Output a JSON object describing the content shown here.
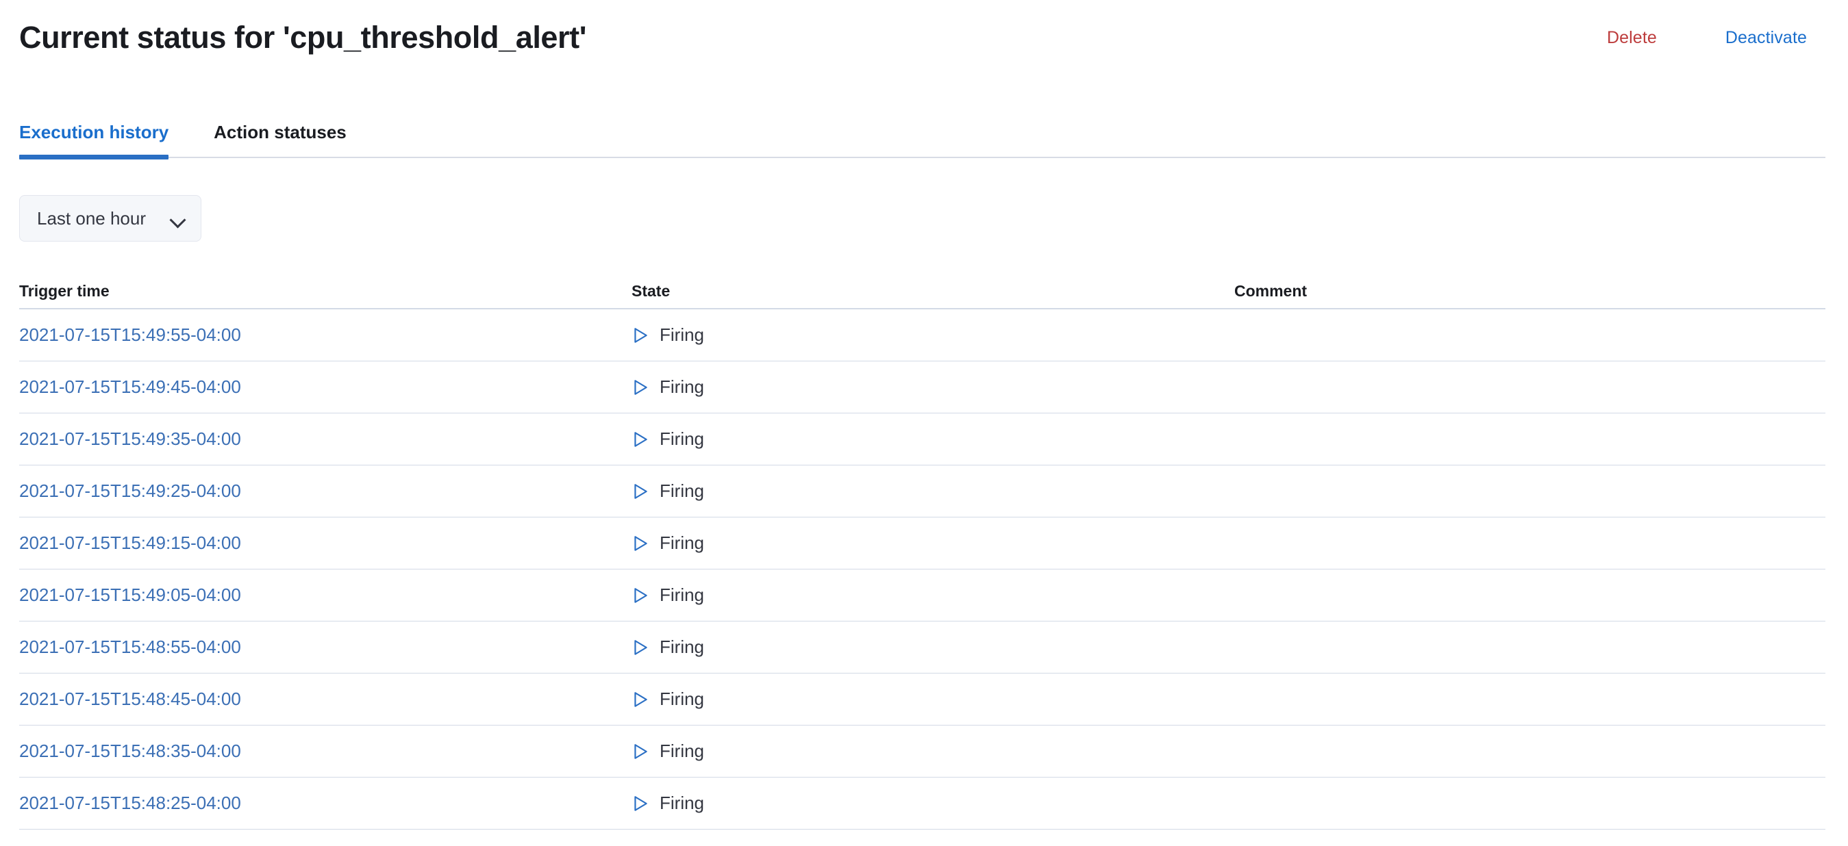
{
  "header": {
    "title": "Current status for 'cpu_threshold_alert'",
    "actions": {
      "delete_label": "Delete",
      "deactivate_label": "Deactivate",
      "delete_color": "#bd3c3c",
      "deactivate_color": "#1a6ecc"
    }
  },
  "tabs": [
    {
      "label": "Execution history",
      "active": true
    },
    {
      "label": "Action statuses",
      "active": false
    }
  ],
  "filter": {
    "selected": "Last one hour",
    "icon": "chevron-down-icon"
  },
  "table": {
    "columns": [
      "Trigger time",
      "State",
      "Comment"
    ],
    "state_icon": "play-triangle-icon",
    "state_icon_color": "#2a6fc4",
    "link_color": "#3b6fb5",
    "rows": [
      {
        "trigger_time": "2021-07-15T15:49:55-04:00",
        "state": "Firing",
        "comment": ""
      },
      {
        "trigger_time": "2021-07-15T15:49:45-04:00",
        "state": "Firing",
        "comment": ""
      },
      {
        "trigger_time": "2021-07-15T15:49:35-04:00",
        "state": "Firing",
        "comment": ""
      },
      {
        "trigger_time": "2021-07-15T15:49:25-04:00",
        "state": "Firing",
        "comment": ""
      },
      {
        "trigger_time": "2021-07-15T15:49:15-04:00",
        "state": "Firing",
        "comment": ""
      },
      {
        "trigger_time": "2021-07-15T15:49:05-04:00",
        "state": "Firing",
        "comment": ""
      },
      {
        "trigger_time": "2021-07-15T15:48:55-04:00",
        "state": "Firing",
        "comment": ""
      },
      {
        "trigger_time": "2021-07-15T15:48:45-04:00",
        "state": "Firing",
        "comment": ""
      },
      {
        "trigger_time": "2021-07-15T15:48:35-04:00",
        "state": "Firing",
        "comment": ""
      },
      {
        "trigger_time": "2021-07-15T15:48:25-04:00",
        "state": "Firing",
        "comment": ""
      }
    ]
  }
}
